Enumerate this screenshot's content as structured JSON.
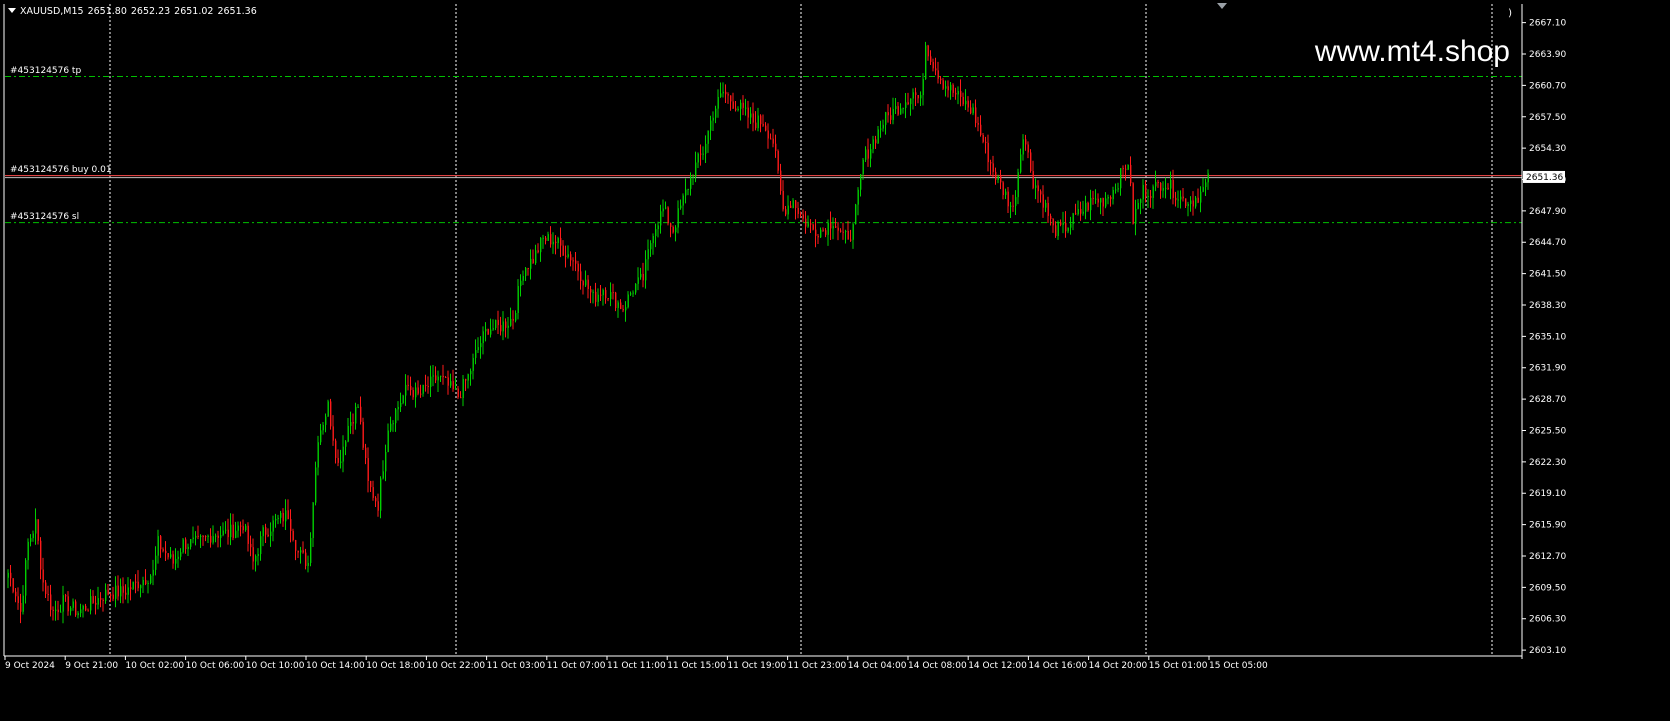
{
  "chart_header": {
    "symbol": "XAUUSD,M15",
    "open": "2651.80",
    "high": "2652.23",
    "low": "2651.02",
    "close": "2651.36"
  },
  "watermark": "www.mt4.shop",
  "scroll_end_glyph": ")",
  "order_lines": [
    {
      "label": "#453124576 tp",
      "price": 2661.6,
      "color": "#00c000"
    },
    {
      "label": "#453124576 buy 0.01",
      "price": 2651.5,
      "color": "#ff4d4d"
    },
    {
      "label": "#453124576 sl",
      "price": 2646.7,
      "color": "#00c000"
    }
  ],
  "colors": {
    "background": "#000000",
    "bull": "#00d000",
    "bear": "#ff1a1a",
    "grid": "#ffffff",
    "axis": "#ffffff",
    "bid_line": "#c0c0c0",
    "price_tag_bg": "#ffffff"
  },
  "chart_data": {
    "type": "candlestick",
    "price_axis": {
      "ticks": [
        "2667.10",
        "2663.90",
        "2660.70",
        "2657.50",
        "2654.30",
        "2651.10",
        "2647.90",
        "2644.70",
        "2641.50",
        "2638.30",
        "2635.10",
        "2631.90",
        "2628.70",
        "2625.50",
        "2622.30",
        "2619.10",
        "2615.90",
        "2612.70",
        "2609.50",
        "2606.30",
        "2603.10"
      ],
      "ylim": [
        2602.5,
        2669.0
      ],
      "current_price": "2651.36"
    },
    "time_axis": {
      "labels": [
        "9 Oct 2024",
        "9 Oct 21:00",
        "10 Oct 02:00",
        "10 Oct 06:00",
        "10 Oct 10:00",
        "10 Oct 14:00",
        "10 Oct 18:00",
        "10 Oct 22:00",
        "11 Oct 03:00",
        "11 Oct 07:00",
        "11 Oct 11:00",
        "11 Oct 15:00",
        "11 Oct 19:00",
        "11 Oct 23:00",
        "14 Oct 04:00",
        "14 Oct 08:00",
        "14 Oct 12:00",
        "14 Oct 16:00",
        "14 Oct 20:00",
        "15 Oct 01:00",
        "15 Oct 05:00"
      ],
      "period_separator_labels": [
        "9 Oct 21:00",
        "10 Oct 22:00",
        "11 Oct 23:00",
        "15 Oct 01:00"
      ]
    },
    "anchors": [
      [
        0,
        2611
      ],
      [
        3,
        2609
      ],
      [
        5,
        2607
      ],
      [
        8,
        2614
      ],
      [
        11,
        2616
      ],
      [
        14,
        2610
      ],
      [
        18,
        2607
      ],
      [
        22,
        2608
      ],
      [
        28,
        2607
      ],
      [
        34,
        2608
      ],
      [
        40,
        2609
      ],
      [
        46,
        2609
      ],
      [
        52,
        2610
      ],
      [
        58,
        2611
      ],
      [
        60,
        2614
      ],
      [
        63,
        2613
      ],
      [
        66,
        2612
      ],
      [
        70,
        2614
      ],
      [
        76,
        2614
      ],
      [
        82,
        2615
      ],
      [
        88,
        2615
      ],
      [
        94,
        2616
      ],
      [
        98,
        2612
      ],
      [
        102,
        2615
      ],
      [
        106,
        2616
      ],
      [
        112,
        2617
      ],
      [
        116,
        2613
      ],
      [
        120,
        2612
      ],
      [
        124,
        2625
      ],
      [
        128,
        2628
      ],
      [
        132,
        2622
      ],
      [
        136,
        2626
      ],
      [
        140,
        2628
      ],
      [
        144,
        2620
      ],
      [
        148,
        2618
      ],
      [
        152,
        2626
      ],
      [
        156,
        2628
      ],
      [
        160,
        2630
      ],
      [
        164,
        2629
      ],
      [
        168,
        2630
      ],
      [
        172,
        2631
      ],
      [
        176,
        2630
      ],
      [
        180,
        2629
      ],
      [
        184,
        2631
      ],
      [
        188,
        2634
      ],
      [
        192,
        2636
      ],
      [
        196,
        2636
      ],
      [
        202,
        2637
      ],
      [
        206,
        2642
      ],
      [
        210,
        2643
      ],
      [
        214,
        2645
      ],
      [
        218,
        2645
      ],
      [
        222,
        2644
      ],
      [
        226,
        2643
      ],
      [
        230,
        2641
      ],
      [
        234,
        2639
      ],
      [
        238,
        2640
      ],
      [
        242,
        2639
      ],
      [
        246,
        2638
      ],
      [
        250,
        2640
      ],
      [
        254,
        2641
      ],
      [
        258,
        2646
      ],
      [
        262,
        2648
      ],
      [
        266,
        2646
      ],
      [
        270,
        2649
      ],
      [
        274,
        2652
      ],
      [
        278,
        2654
      ],
      [
        282,
        2658
      ],
      [
        286,
        2660
      ],
      [
        290,
        2659
      ],
      [
        294,
        2658
      ],
      [
        298,
        2657
      ],
      [
        302,
        2657
      ],
      [
        306,
        2655
      ],
      [
        310,
        2648
      ],
      [
        314,
        2649
      ],
      [
        318,
        2647
      ],
      [
        322,
        2646
      ],
      [
        326,
        2646
      ],
      [
        330,
        2647
      ],
      [
        334,
        2645
      ],
      [
        338,
        2646
      ],
      [
        342,
        2653
      ],
      [
        346,
        2655
      ],
      [
        350,
        2657
      ],
      [
        354,
        2658
      ],
      [
        358,
        2659
      ],
      [
        362,
        2660
      ],
      [
        365,
        2659
      ],
      [
        367,
        2665
      ],
      [
        370,
        2663
      ],
      [
        374,
        2661
      ],
      [
        378,
        2660
      ],
      [
        382,
        2659
      ],
      [
        386,
        2658
      ],
      [
        390,
        2655
      ],
      [
        394,
        2652
      ],
      [
        398,
        2650
      ],
      [
        402,
        2648
      ],
      [
        406,
        2656
      ],
      [
        410,
        2651
      ],
      [
        414,
        2649
      ],
      [
        418,
        2646
      ],
      [
        422,
        2646
      ],
      [
        426,
        2647
      ],
      [
        430,
        2648
      ],
      [
        434,
        2649
      ],
      [
        438,
        2649
      ],
      [
        442,
        2650
      ],
      [
        446,
        2652
      ],
      [
        448,
        2653
      ],
      [
        450,
        2647
      ],
      [
        454,
        2650
      ],
      [
        458,
        2650
      ],
      [
        462,
        2651
      ],
      [
        466,
        2650
      ],
      [
        470,
        2649
      ],
      [
        474,
        2649
      ],
      [
        478,
        2650
      ],
      [
        480,
        2651
      ]
    ],
    "candle_count": 481
  }
}
